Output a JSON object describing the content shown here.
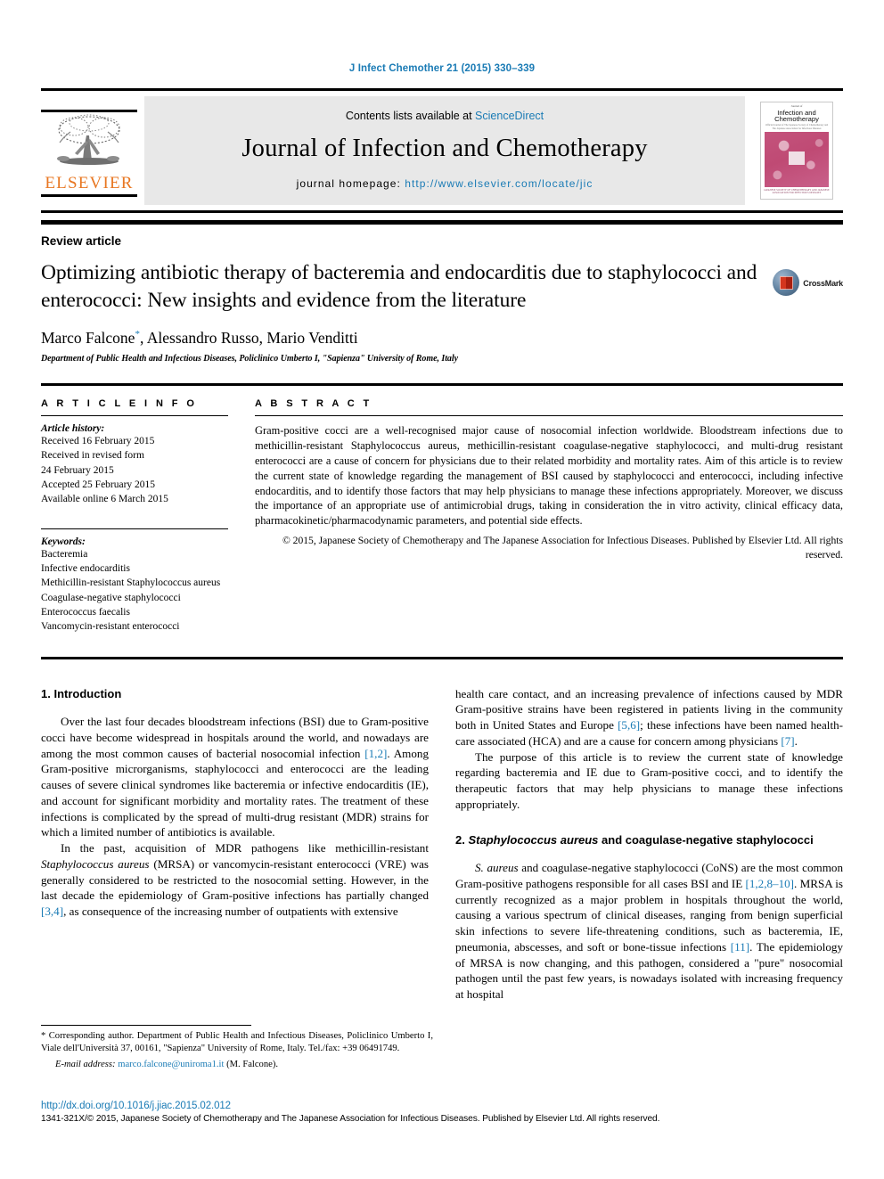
{
  "running_head": "J Infect Chemother 21 (2015) 330–339",
  "masthead": {
    "contents_prefix": "Contents lists available at ",
    "sciencedirect": "ScienceDirect",
    "journal_title": "Journal of Infection and Chemotherapy",
    "homepage_prefix": "journal homepage: ",
    "homepage_url": "http://www.elsevier.com/locate/jic",
    "publisher_logo_text": "ELSEVIER",
    "publisher_logo_icon": "elsevier-tree-icon",
    "cover": {
      "top_label": "Journal of",
      "title": "Infection and Chemotherapy",
      "subtitle": "Official Journal of The Japanese Society of Chemotherapy and The Japanese Association for Infectious Diseases",
      "footer": "JAPANESE SOCIETY OF CHEMOTHERAPY AND JAPANESE ASSOCIATION FOR INFECTIOUS DISEASES"
    },
    "accent_color": "#1a7bb5",
    "elsevier_orange": "#e87722"
  },
  "article": {
    "type": "Review article",
    "title": "Optimizing antibiotic therapy of bacteremia and endocarditis due to staphylococci and enterococci: New insights and evidence from the literature",
    "authors": "Marco Falcone",
    "authors_rest": ", Alessandro Russo, Mario Venditti",
    "corresponding_marker": "*",
    "affiliation": "Department of Public Health and Infectious Diseases, Policlinico Umberto I, \"Sapienza\" University of Rome, Italy",
    "crossmark_label": "CrossMark",
    "crossmark_icon": "crossmark-badge-icon"
  },
  "info": {
    "heading": "A R T I C L E   I N F O",
    "history_heading": "Article history:",
    "history": [
      "Received 16 February 2015",
      "Received in revised form",
      "24 February 2015",
      "Accepted 25 February 2015",
      "Available online 6 March 2015"
    ],
    "keywords_heading": "Keywords:",
    "keywords": [
      "Bacteremia",
      "Infective endocarditis",
      "Methicillin-resistant Staphylococcus aureus",
      "Coagulase-negative staphylococci",
      "Enterococcus faecalis",
      "Vancomycin-resistant enterococci"
    ]
  },
  "abstract": {
    "heading": "A B S T R A C T",
    "text": "Gram-positive cocci are a well-recognised major cause of nosocomial infection worldwide. Bloodstream infections due to methicillin-resistant Staphylococcus aureus, methicillin-resistant coagulase-negative staphylococci, and multi-drug resistant enterococci are a cause of concern for physicians due to their related morbidity and mortality rates. Aim of this article is to review the current state of knowledge regarding the management of BSI caused by staphylococci and enterococci, including infective endocarditis, and to identify those factors that may help physicians to manage these infections appropriately. Moreover, we discuss the importance of an appropriate use of antimicrobial drugs, taking in consideration the in vitro activity, clinical efficacy data, pharmacokinetic/pharmacodynamic parameters, and potential side effects.",
    "copyright": "© 2015, Japanese Society of Chemotherapy and The Japanese Association for Infectious Diseases. Published by Elsevier Ltd. All rights reserved."
  },
  "body": {
    "left": {
      "section1_heading": "1. Introduction",
      "p1_a": "Over the last four decades bloodstream infections (BSI) due to Gram-positive cocci have become widespread in hospitals around the world, and nowadays are among the most common causes of bacterial nosocomial infection ",
      "p1_ref1": "[1,2]",
      "p1_b": ". Among Gram-positive microrganisms, staphylococci and enterococci are the leading causes of severe clinical syndromes like bacteremia or infective endocarditis (IE), and account for significant morbidity and mortality rates. The treatment of these infections is complicated by the spread of multi-drug resistant (MDR) strains for which a limited number of antibiotics is available.",
      "p2_a": "In the past, acquisition of MDR pathogens like methicillin-resistant ",
      "p2_italic": "Staphylococcus aureus",
      "p2_b": " (MRSA) or vancomycin-resistant enterococci (VRE) was generally considered to be restricted to the nosocomial setting. However, in the last decade the epidemiology of Gram-positive infections has partially changed ",
      "p2_ref": "[3,4]",
      "p2_c": ", as consequence of the increasing number of outpatients with extensive"
    },
    "right": {
      "p3_a": "health care contact, and an increasing prevalence of infections caused by MDR Gram-positive strains have been registered in patients living in the community both in United States and Europe ",
      "p3_ref1": "[5,6]",
      "p3_b": "; these infections have been named health-care associated (HCA) and are a cause for concern among physicians ",
      "p3_ref2": "[7]",
      "p3_c": ".",
      "p4": "The purpose of this article is to review the current state of knowledge regarding bacteremia and IE due to Gram-positive cocci, and to identify the therapeutic factors that may help physicians to manage these infections appropriately.",
      "section2_num": "2. ",
      "section2_italic": "Staphylococcus aureus",
      "section2_rest": " and coagulase-negative staphylococci",
      "p5_italic": "S. aureus",
      "p5_a": " and coagulase-negative staphylococci (CoNS) are the most common Gram-positive pathogens responsible for all cases BSI and IE ",
      "p5_ref1": "[1,2,8–10]",
      "p5_b": ". MRSA is currently recognized as a major problem in hospitals throughout the world, causing a various spectrum of clinical diseases, ranging from benign superficial skin infections to severe life-threatening conditions, such as bacteremia, IE, pneumonia, abscesses, and soft or bone-tissue infections ",
      "p5_ref2": "[11]",
      "p5_c": ". The epidemiology of MRSA is now changing, and this pathogen, considered a \"pure\" nosocomial pathogen until the past few years, is nowadays isolated with increasing frequency at hospital"
    }
  },
  "footnotes": {
    "corresponding": "* Corresponding author. Department of Public Health and Infectious Diseases, Policlinico Umberto I, Viale dell'Università 37, 00161, \"Sapienza\" University of Rome, Italy. Tel./fax: +39 06491749.",
    "email_label": "E-mail address:",
    "email": "marco.falcone@uniroma1.it",
    "email_suffix": "(M. Falcone).",
    "doi": "http://dx.doi.org/10.1016/j.jiac.2015.02.012",
    "issn": "1341-321X/© 2015, Japanese Society of Chemotherapy and The Japanese Association for Infectious Diseases. Published by Elsevier Ltd. All rights reserved."
  }
}
